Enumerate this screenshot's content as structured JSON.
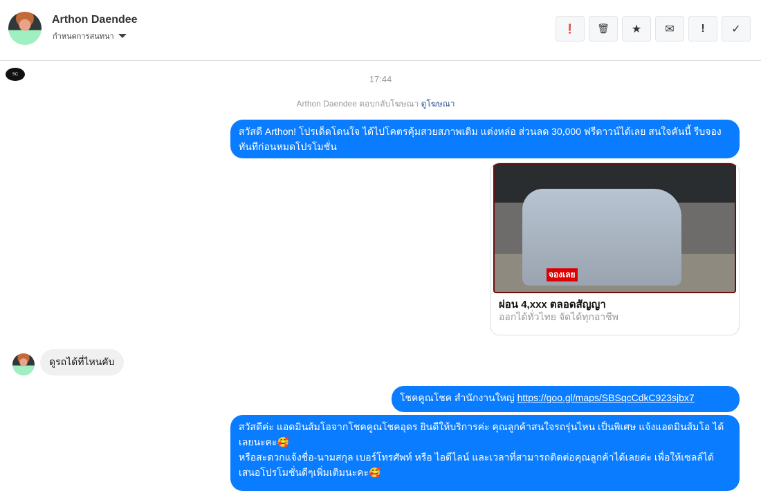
{
  "header": {
    "name": "Arthon Daendee",
    "subtitle": "กำหนดการสนทนา",
    "buttons": [
      {
        "icon": "alert-circle-icon",
        "glyph": "❗"
      },
      {
        "icon": "trash-icon",
        "glyph": "🗑"
      },
      {
        "icon": "star-icon",
        "glyph": "★"
      },
      {
        "icon": "envelope-icon",
        "glyph": "✉"
      },
      {
        "icon": "exclamation-icon",
        "glyph": "!"
      },
      {
        "icon": "check-icon",
        "glyph": "✓"
      }
    ]
  },
  "chat": {
    "time": "17:44",
    "notice": {
      "text": "Arthon Daendee ตอบกลับโฆษณา",
      "link": "ดูโฆษณา"
    },
    "msg1": "สวัสดี Arthon! โปรเด็ดโดนใจ ได้ไปโคตรคุ้มสวยสภาพเดิม แต่งหล่อ  ส่วนลด 30,000 ฟรีดาวน์ได้เลย  สนใจคันนี้ รีบจองทันทีก่อนหมดโปรโมชั่น",
    "card": {
      "title": "ผ่อน 4,xxx ตลอดสัญญา",
      "subtitle": "ออกได้ทั่วไทย จัดได้ทุกอาชีพ",
      "image_tag": "จองเลย"
    },
    "incoming": "ดูรถได้ที่ไหนคับ",
    "msg3": {
      "text": "โชคคูณโชค สำนักงานใหญ่ ",
      "link": "https://goo.gl/maps/SBSqcCdkC923sjbx7"
    },
    "msg4": [
      "สวัสดีค่ะ แอดมินส้มโอจากโชคคูณโชคอุดร ยินดีให้บริการค่ะ   คุณลูกค้าสนใจรถรุ่นไหน เป็นพิเศษ แจ้งแอดมินส้มโอ ได้เลยนะคะ🥰",
      "หรือสะดวกแจ้งชื่อ-นามสกุล เบอร์โทรศัพท์ หรือ ไอดีไลน์ และเวลาที่สามารถติดต่อคุณลูกค้าได้เลยค่ะ เพื่อให้เซลล์ได้เสนอโปรโมชั่นดีๆเพิ่มเติมนะคะ🥰"
    ]
  },
  "colors": {
    "accent": "#0a7cff"
  }
}
